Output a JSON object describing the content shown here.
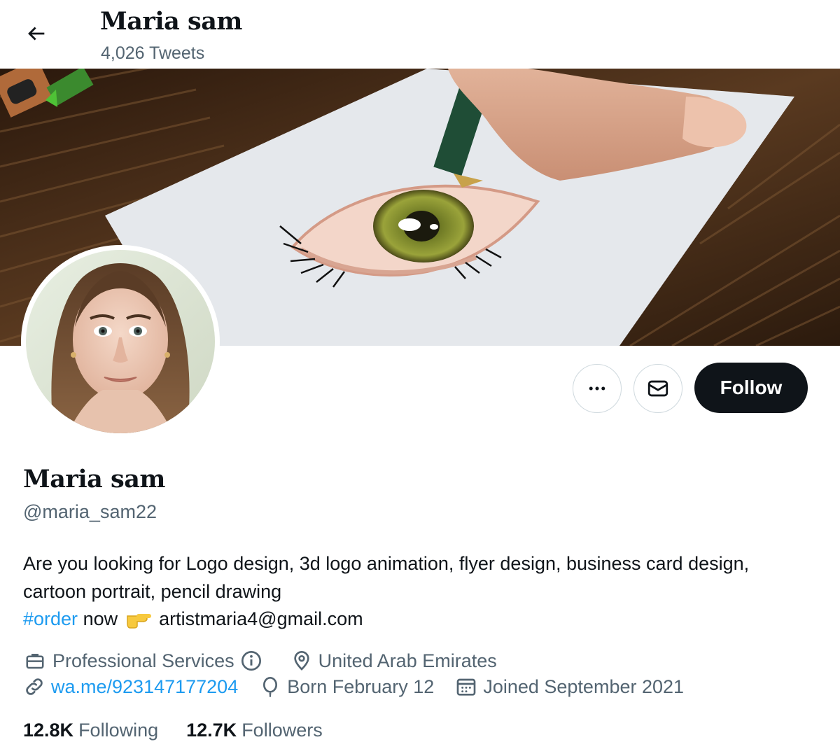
{
  "header": {
    "title": "Maria sam",
    "tweet_count": "4,026 Tweets",
    "back_icon": "arrow-left-icon"
  },
  "banner": {
    "subject": "pencil drawing of an eye"
  },
  "actions": {
    "more_icon": "more-dots-icon",
    "message_icon": "envelope-icon",
    "follow_label": "Follow"
  },
  "profile": {
    "name": "Maria sam",
    "handle": "@maria_sam22",
    "bio_line1": "Are you looking for Logo design, 3d logo animation, flyer design, business card design, cartoon portrait, pencil drawing",
    "hashtag": "#order",
    "bio_now": "now",
    "emoji": "👉",
    "email": "artistmaria4@gmail.com"
  },
  "meta": {
    "category": "Professional Services",
    "location": "United Arab Emirates",
    "website": "wa.me/923147177204",
    "birthday": "Born February 12",
    "joined": "Joined September 2021"
  },
  "stats": {
    "following_count": "12.8K",
    "following_label": "Following",
    "followers_count": "12.7K",
    "followers_label": "Followers"
  },
  "colors": {
    "accent": "#1d9bf0",
    "text": "#0f1419",
    "secondary": "#536471",
    "border": "#cfd9de"
  }
}
